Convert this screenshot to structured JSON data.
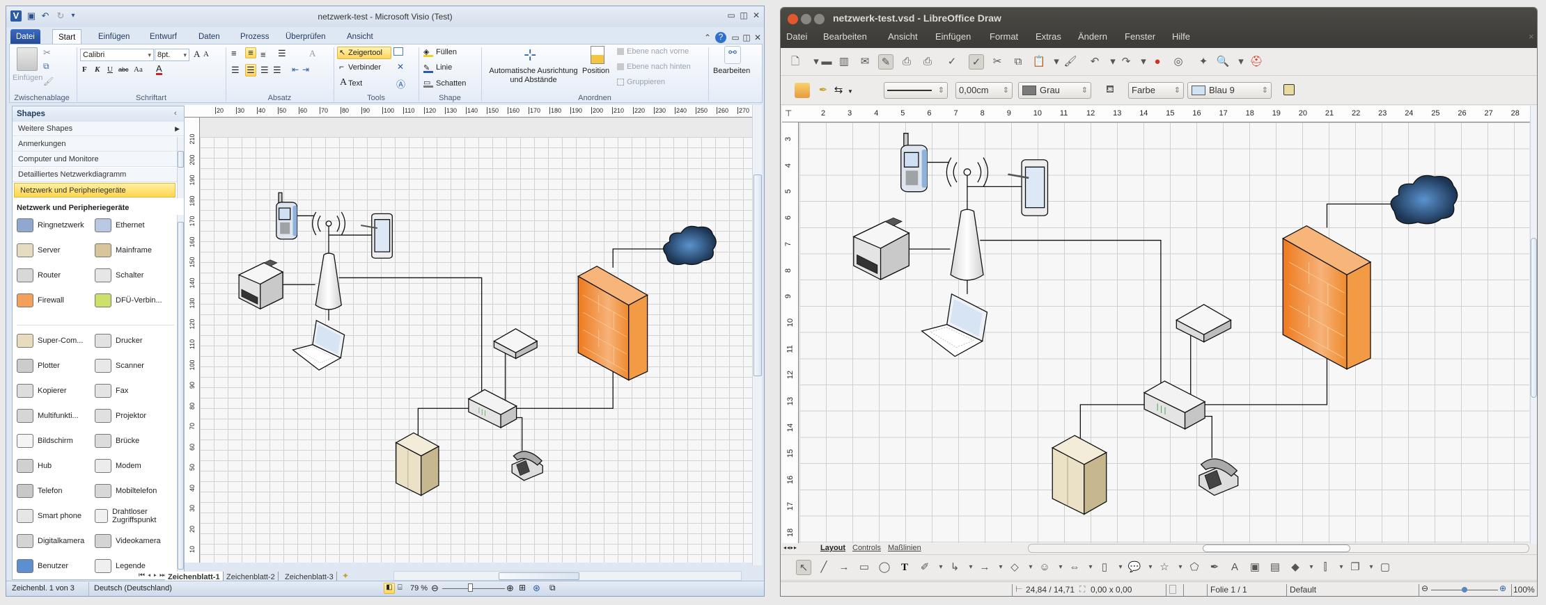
{
  "visio": {
    "title": "netzwerk-test - Microsoft Visio (Test)",
    "tabs": [
      "Datei",
      "Start",
      "Einfügen",
      "Entwurf",
      "Daten",
      "Prozess",
      "Überprüfen",
      "Ansicht"
    ],
    "ribbon": {
      "clipboard": {
        "paste": "Einfügen",
        "label": "Zwischenablage"
      },
      "font": {
        "name": "Calibri",
        "size": "8pt.",
        "bold": "F",
        "italic": "K",
        "underline": "U",
        "strike": "abc",
        "case": "Aa",
        "grow": "A",
        "shrink": "A",
        "color": "A",
        "label": "Schriftart"
      },
      "paragraph": {
        "label": "Absatz"
      },
      "tools": {
        "pointer": "Zeigertool",
        "connector": "Verbinder",
        "text": "Text",
        "label": "Tools"
      },
      "shape": {
        "fill": "Füllen",
        "line": "Linie",
        "shadow": "Schatten",
        "label": "Shape"
      },
      "arrange": {
        "auto_align_1": "Automatische Ausrichtung",
        "auto_align_2": "und Abstände",
        "position": "Position",
        "bring_forward": "Ebene nach vorne",
        "send_backward": "Ebene nach hinten",
        "group": "Gruppieren",
        "label": "Anordnen"
      },
      "edit": {
        "label": "Bearbeiten"
      }
    },
    "shapes_panel": {
      "title": "Shapes",
      "more": "Weitere Shapes",
      "categories": [
        "Anmerkungen",
        "Computer und Monitore",
        "Detailliertes Netzwerkdiagramm",
        "Netzwerk und Peripheriegeräte"
      ],
      "stencil_title": "Netzwerk und Peripheriegeräte",
      "group1": [
        {
          "label": "Ringnetzwerk",
          "icon": "ring-network-icon",
          "color": "#8fa8cf"
        },
        {
          "label": "Ethernet",
          "icon": "ethernet-icon",
          "color": "#b9c9e4"
        },
        {
          "label": "Server",
          "icon": "server-icon",
          "color": "#e6dcc0"
        },
        {
          "label": "Mainframe",
          "icon": "mainframe-icon",
          "color": "#d9c59c"
        },
        {
          "label": "Router",
          "icon": "router-icon",
          "color": "#d8d8d8"
        },
        {
          "label": "Schalter",
          "icon": "switch-icon",
          "color": "#e6e6e6"
        },
        {
          "label": "Firewall",
          "icon": "firewall-icon",
          "color": "#f2a05a"
        },
        {
          "label": "DFÜ-Verbin...",
          "icon": "dialup-icon",
          "color": "#cfe06a"
        }
      ],
      "group2": [
        {
          "label": "Super-Com...",
          "icon": "supercomputer-icon",
          "color": "#e8dcbc"
        },
        {
          "label": "Drucker",
          "icon": "printer-icon",
          "color": "#e2e2e2"
        },
        {
          "label": "Plotter",
          "icon": "plotter-icon",
          "color": "#cccccc"
        },
        {
          "label": "Scanner",
          "icon": "scanner-icon",
          "color": "#e8e8e8"
        },
        {
          "label": "Kopierer",
          "icon": "copier-icon",
          "color": "#dddddd"
        },
        {
          "label": "Fax",
          "icon": "fax-icon",
          "color": "#e4e4e4"
        },
        {
          "label": "Multifunkti...",
          "icon": "multifunction-icon",
          "color": "#d6d6d6"
        },
        {
          "label": "Projektor",
          "icon": "projector-icon",
          "color": "#e0e0e0"
        },
        {
          "label": "Bildschirm",
          "icon": "projection-screen-icon",
          "color": "#f4f4f4"
        },
        {
          "label": "Brücke",
          "icon": "bridge-icon",
          "color": "#dcdcdc"
        },
        {
          "label": "Hub",
          "icon": "hub-icon",
          "color": "#d0d0d0"
        },
        {
          "label": "Modem",
          "icon": "modem-icon",
          "color": "#ececec"
        },
        {
          "label": "Telefon",
          "icon": "telephone-icon",
          "color": "#c8c8c8"
        },
        {
          "label": "Mobiltelefon",
          "icon": "mobile-phone-icon",
          "color": "#d8d8d8"
        },
        {
          "label": "Smart phone",
          "icon": "smartphone-icon",
          "color": "#e6e6e6"
        },
        {
          "label": "Drahtloser Zugriffspunkt",
          "icon": "wireless-access-point-icon",
          "color": "#f0f0f0"
        },
        {
          "label": "Digitalkamera",
          "icon": "digital-camera-icon",
          "color": "#d4d4d4"
        },
        {
          "label": "Videokamera",
          "icon": "video-camera-icon",
          "color": "#d4d4d4"
        },
        {
          "label": "Benutzer",
          "icon": "user-icon",
          "color": "#5b8fd0"
        },
        {
          "label": "Legende",
          "icon": "legend-icon",
          "color": "#efefef"
        }
      ]
    },
    "ruler_h": [
      "20",
      "30",
      "40",
      "50",
      "60",
      "70",
      "80",
      "90",
      "100",
      "110",
      "120",
      "130",
      "140",
      "150",
      "160",
      "170",
      "180",
      "190",
      "200",
      "210",
      "220",
      "230",
      "240",
      "250",
      "260",
      "270"
    ],
    "ruler_v": [
      "210",
      "200",
      "190",
      "180",
      "170",
      "160",
      "150",
      "140",
      "130",
      "120",
      "110",
      "100",
      "90",
      "80",
      "70",
      "60",
      "50",
      "40",
      "30",
      "20",
      "10"
    ],
    "sheets": [
      "Zeichenblatt-1",
      "Zeichenblatt-2",
      "Zeichenblatt-3"
    ],
    "status": {
      "page": "Zeichenbl. 1 von 3",
      "language": "Deutsch (Deutschland)",
      "zoom": "79 %",
      "zoom_percent": 79
    }
  },
  "lo": {
    "title": "netzwerk-test.vsd - LibreOffice Draw",
    "menu": [
      "Datei",
      "Bearbeiten",
      "Ansicht",
      "Einfügen",
      "Format",
      "Extras",
      "Ändern",
      "Fenster",
      "Hilfe"
    ],
    "line_width": "0,00cm",
    "line_color": "Grau",
    "fill_type": "Farbe",
    "fill_color": "Blau 9",
    "colors": {
      "line": "#7a7a7a",
      "fill": "#cfe3f5",
      "shadow": "#e8dba0"
    },
    "ruler_h": [
      "2",
      "3",
      "4",
      "5",
      "6",
      "7",
      "8",
      "9",
      "10",
      "11",
      "12",
      "13",
      "14",
      "15",
      "16",
      "17",
      "18",
      "19",
      "20",
      "21",
      "22",
      "23",
      "24",
      "25",
      "26",
      "27",
      "28"
    ],
    "ruler_v": [
      "3",
      "4",
      "5",
      "6",
      "7",
      "8",
      "9",
      "10",
      "11",
      "12",
      "13",
      "14",
      "15",
      "16",
      "17",
      "18"
    ],
    "tabs": [
      "Layout",
      "Controls",
      "Maßlinien"
    ],
    "status": {
      "position": "24,84 / 14,71",
      "size": "0,00 x 0,00",
      "page": "Folie 1 / 1",
      "layout": "Default",
      "zoom": "100%",
      "zoom_percent": 100
    }
  }
}
